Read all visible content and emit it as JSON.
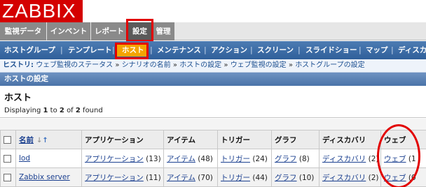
{
  "brand": {
    "logo_text": "ZABBIX",
    "logo_color": "#d40000"
  },
  "main_menu": [
    {
      "label": "監視データ"
    },
    {
      "label": "インベントリ"
    },
    {
      "label": "レポート"
    },
    {
      "label": "設定",
      "active": true
    },
    {
      "label": "管理"
    }
  ],
  "sub_menu": [
    {
      "label": "ホストグループ"
    },
    {
      "label": "テンプレート"
    },
    {
      "label": "ホスト",
      "active": true
    },
    {
      "label": "メンテナンス"
    },
    {
      "label": "アクション"
    },
    {
      "label": "スクリーン"
    },
    {
      "label": "スライドショー"
    },
    {
      "label": "マップ"
    },
    {
      "label": "ディスカ"
    }
  ],
  "history": {
    "label": "ヒストリ:",
    "items": [
      "ウェブ監視のステータス",
      "シナリオの名前",
      "ホストの設定",
      "ウェブ監視の設定",
      "ホストグループの設定"
    ],
    "separator": "»"
  },
  "section_title": "ホストの設定",
  "panel": {
    "title": "ホスト",
    "count_prefix": "Displaying",
    "count_from": "1",
    "count_to_word": "to",
    "count_to": "2",
    "count_of_word": "of",
    "count_total": "2",
    "count_suffix": "found"
  },
  "table": {
    "columns": [
      "名前",
      "アプリケーション",
      "アイテム",
      "トリガー",
      "グラフ",
      "ディスカバリ",
      "ウェブ"
    ],
    "rows": [
      {
        "name": "lod",
        "applications": {
          "label": "アプリケーション",
          "count": "(13)"
        },
        "items": {
          "label": "アイテム",
          "count": "(48)"
        },
        "triggers": {
          "label": "トリガー",
          "count": "(24)"
        },
        "graphs": {
          "label": "グラフ",
          "count": "(8)"
        },
        "discovery": {
          "label": "ディスカバリ",
          "count": "(2)"
        },
        "web": {
          "label": "ウェブ",
          "count": "(1"
        }
      },
      {
        "name": "Zabbix server",
        "applications": {
          "label": "アプリケーション",
          "count": "(11)"
        },
        "items": {
          "label": "アイテム",
          "count": "(70)"
        },
        "triggers": {
          "label": "トリガー",
          "count": "(44)"
        },
        "graphs": {
          "label": "グラフ",
          "count": "(10)"
        },
        "discovery": {
          "label": "ディスカバリ",
          "count": "(2)"
        },
        "web": {
          "label": "ウェブ",
          "count": "(0"
        }
      }
    ]
  },
  "colors": {
    "accent": "#f4a400",
    "nav_blue": "#2f5f9a",
    "annotation_red": "#e20000"
  }
}
